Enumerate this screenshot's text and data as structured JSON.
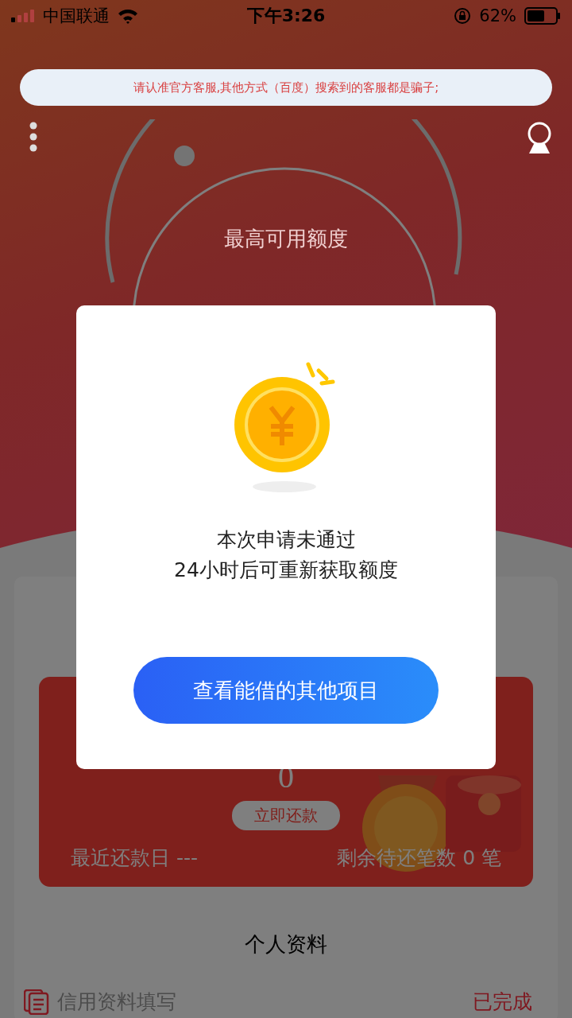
{
  "status_bar": {
    "carrier": "中国联通",
    "time": "下午3:26",
    "battery": "62%"
  },
  "notice": "请认准官方客服,其他方式（百度）搜索到的客服都是骗子;",
  "quota": {
    "label": "最高可用额度"
  },
  "repayment": {
    "amount": "0",
    "button": "立即还款",
    "next_date": "最近还款日 ---",
    "remaining": "剩余待还笔数 0 笔"
  },
  "profile": {
    "title": "个人资料",
    "items": [
      {
        "label": "信用资料填写",
        "status": "已完成"
      }
    ]
  },
  "dialog": {
    "lines": [
      "本次申请未通过",
      "24小时后可重新获取额度"
    ],
    "button": "查看能借的其他项目"
  }
}
